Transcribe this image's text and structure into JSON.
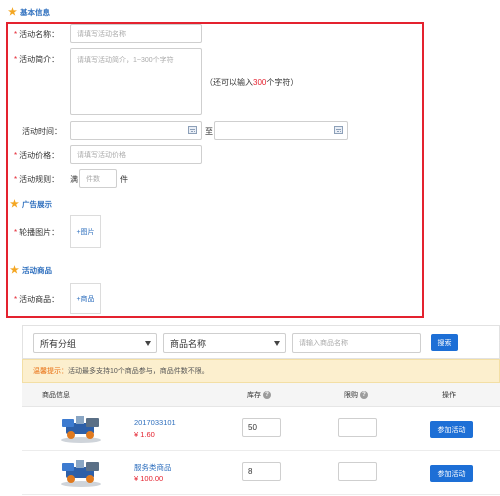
{
  "sections": {
    "basic_info": "基本信息",
    "ad_display": "广告展示",
    "activity_products": "活动商品"
  },
  "form": {
    "required_mark": "*",
    "name_label": "活动名称：",
    "name_placeholder": "请填写活动名称",
    "intro_label": "活动简介：",
    "intro_placeholder": "请填写活动简介，1~300个字符",
    "intro_hint_prefix": "（还可以输入",
    "intro_hint_count": "300",
    "intro_hint_suffix": "个字符）",
    "time_label": "活动时间：",
    "time_to": "至",
    "price_label": "活动价格：",
    "price_placeholder": "请填写活动价格",
    "rule_label": "活动规则：",
    "rule_prefix": "满",
    "rule_placeholder": "件数",
    "rule_suffix": "件",
    "carousel_label": "轮播图片：",
    "carousel_button": "+图片",
    "products_label": "活动商品：",
    "products_button": "+商品"
  },
  "toolbar": {
    "group_select": "所有分组",
    "field_select": "商品名称",
    "search_placeholder": "请输入商品名称",
    "search_button": "搜索"
  },
  "notice": {
    "tip_label": "温馨提示：",
    "text": "活动最多支持10个商品参与，商品件数不限。"
  },
  "table": {
    "headers": {
      "product_info": "商品信息",
      "stock": "库存",
      "limit": "限购",
      "action": "操作"
    },
    "help_icon": "?",
    "rows": [
      {
        "name": "2017033101",
        "price": "¥ 1.60",
        "stock": "50",
        "limit": "",
        "action": "参加活动"
      },
      {
        "name": "服务类商品",
        "price": "¥ 100.00",
        "stock": "8",
        "limit": "",
        "action": "参加活动"
      }
    ]
  },
  "icons": {
    "star": "★",
    "calendar": "calendar-icon",
    "dropdown": "chevron-down-icon",
    "help": "question-icon"
  },
  "colors": {
    "accent_blue": "#1d6fd6",
    "highlight_red": "#e4222f",
    "star_orange": "#f4a621",
    "notice_bg": "#fcefce"
  }
}
